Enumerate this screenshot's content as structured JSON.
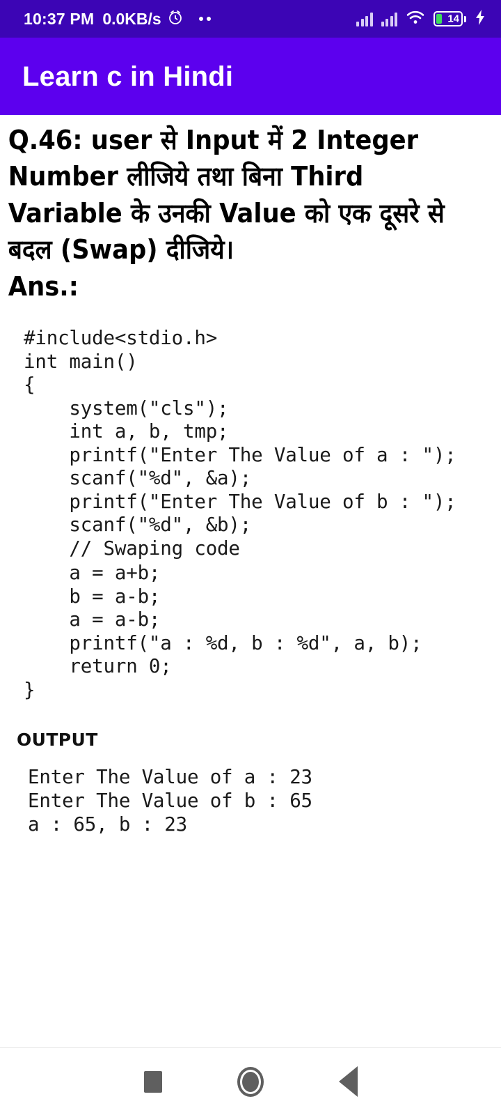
{
  "status_bar": {
    "clock": "10:37 PM",
    "network_speed": "0.0KB/s",
    "alarm_icon": "alarm-clock-icon",
    "notification_dots": "notification-dots-icon",
    "signal_icon": "signal-bars-icon",
    "signal_icon_2": "signal-bars-icon-sim2",
    "wifi_icon": "wifi-icon",
    "battery_level": "14",
    "charging_icon": "charging-bolt-icon",
    "background_color": "#3c05b5"
  },
  "app_bar": {
    "title": "Learn c in Hindi",
    "background_color": "#5c00ee",
    "text_color": "#ffffff"
  },
  "content": {
    "question": "Q.46: user से Input में 2 Integer Number लीजिये तथा बिना Third Variable के उनकी Value को एक दूसरे से बदल (Swap) दीजिये।",
    "answer_label": "Ans.:",
    "code": "#include<stdio.h>\nint main()\n{\n    system(\"cls\");\n    int a, b, tmp;\n    printf(\"Enter The Value of a : \");\n    scanf(\"%d\", &a);\n    printf(\"Enter The Value of b : \");\n    scanf(\"%d\", &b);\n    // Swaping code",
    "code_part2": "    a = a+b;\n    b = a-b;\n    a = a-b;\n    printf(\"a : %d, b : %d\", a, b);\n    return 0;\n}",
    "output_label": "OUTPUT",
    "output": "Enter The Value of a : 23\nEnter The Value of b : 65\na : 65, b : 23"
  },
  "nav_bar": {
    "recents_icon": "square-recents-icon",
    "home_icon": "circle-home-icon",
    "back_icon": "triangle-back-icon"
  }
}
